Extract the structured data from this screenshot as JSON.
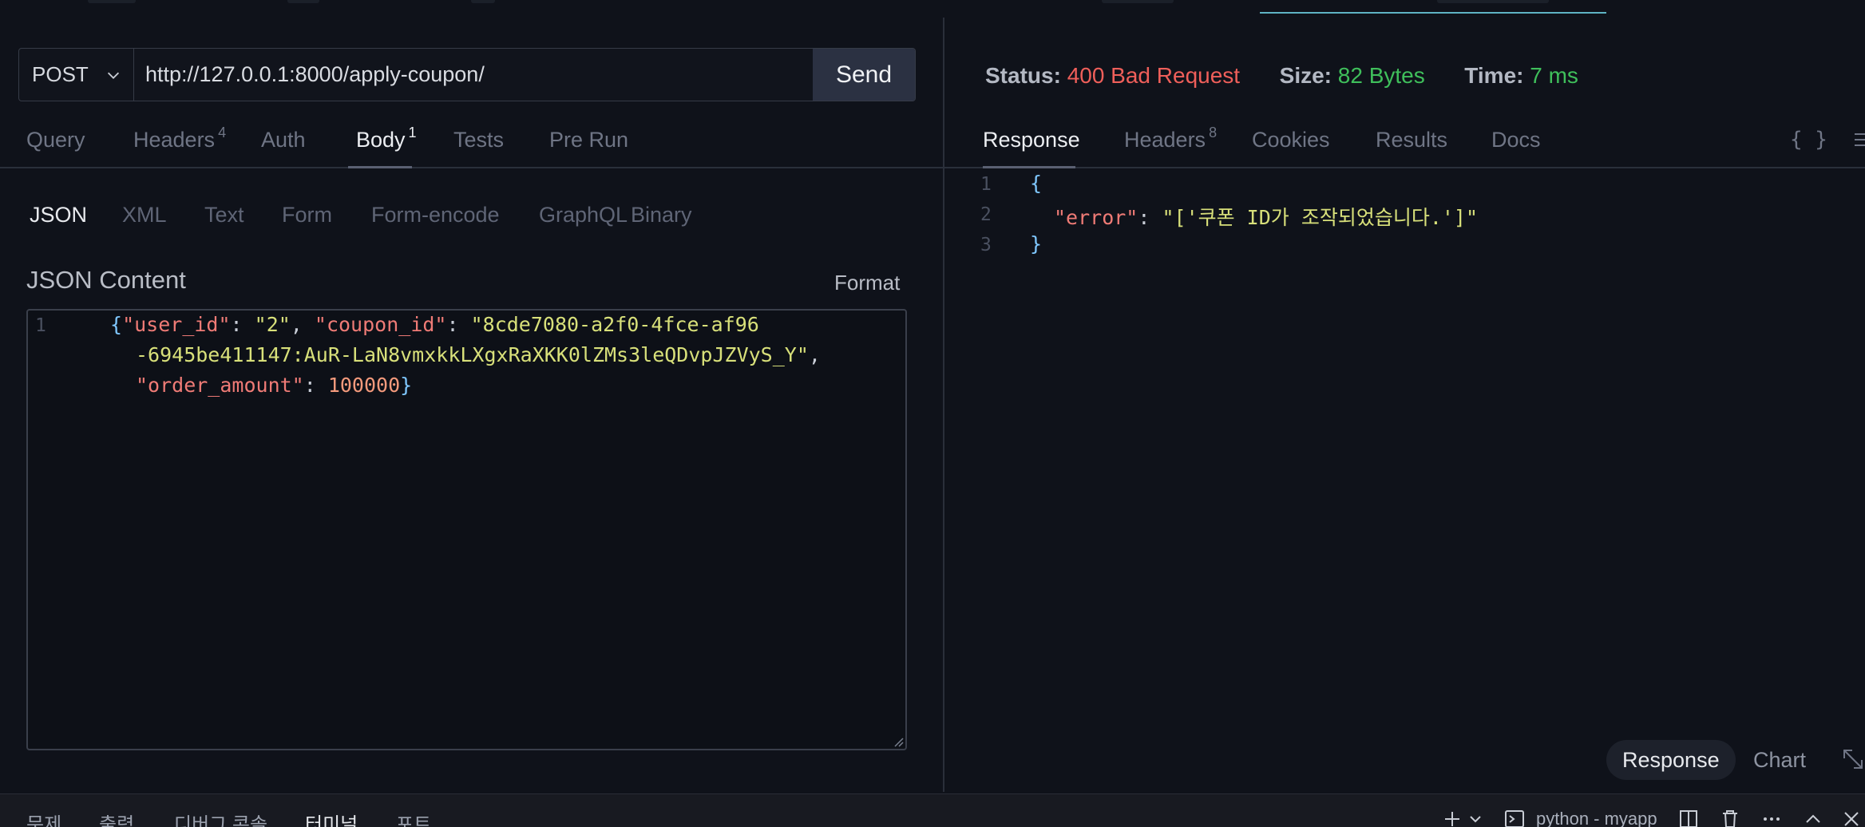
{
  "request": {
    "method": "POST",
    "url": "http://127.0.0.1:8000/apply-coupon/",
    "send_label": "Send",
    "tabs": [
      {
        "label": "Query",
        "badge": ""
      },
      {
        "label": "Headers",
        "badge": "4"
      },
      {
        "label": "Auth",
        "badge": ""
      },
      {
        "label": "Body",
        "badge": "1"
      },
      {
        "label": "Tests",
        "badge": ""
      },
      {
        "label": "Pre Run",
        "badge": ""
      }
    ],
    "active_tab": "Body",
    "body_types": [
      "JSON",
      "XML",
      "Text",
      "Form",
      "Form-encode",
      "GraphQL",
      "Binary"
    ],
    "active_body_type": "JSON",
    "content_label": "JSON Content",
    "format_label": "Format",
    "editor": {
      "line_numbers": [
        "1"
      ],
      "lines": [
        "{\"user_id\": \"2\", \"coupon_id\": \"8cde7080-a2f0-4fce-af96",
        "-6945be411147:AuR-LaN8vmxkkLXgxRaXKK0lZMs3leQDvpJZVyS_Y\",",
        "\"order_amount\": 100000}"
      ]
    }
  },
  "response": {
    "status_label": "Status:",
    "status_value": "400 Bad Request",
    "size_label": "Size:",
    "size_value": "82 Bytes",
    "time_label": "Time:",
    "time_value": "7 ms",
    "tabs": [
      {
        "label": "Response",
        "badge": ""
      },
      {
        "label": "Headers",
        "badge": "8"
      },
      {
        "label": "Cookies",
        "badge": ""
      },
      {
        "label": "Results",
        "badge": ""
      },
      {
        "label": "Docs",
        "badge": ""
      }
    ],
    "active_tab": "Response",
    "braces_icon": "{ }",
    "line_numbers": [
      "1",
      "2",
      "3"
    ],
    "lines": [
      "{",
      "\"error\": \"['쿠폰 ID가 조작되었습니다.']\"",
      "}"
    ],
    "view_modes": [
      "Response",
      "Chart"
    ],
    "active_view": "Response"
  },
  "bottom_panel": {
    "tabs": [
      "문제",
      "출력",
      "디버그 콘솔",
      "터미널",
      "포트"
    ],
    "active_tab": "터미널",
    "terminal_name": "python - myapp"
  },
  "colors": {
    "background": "#0f121a",
    "status_error": "#ef5f5a",
    "status_ok": "#3fbf5b",
    "json_key": "#ef7b76",
    "json_string": "#d8e07a",
    "json_number": "#f49a7c",
    "json_brace": "#7fc7ff"
  }
}
